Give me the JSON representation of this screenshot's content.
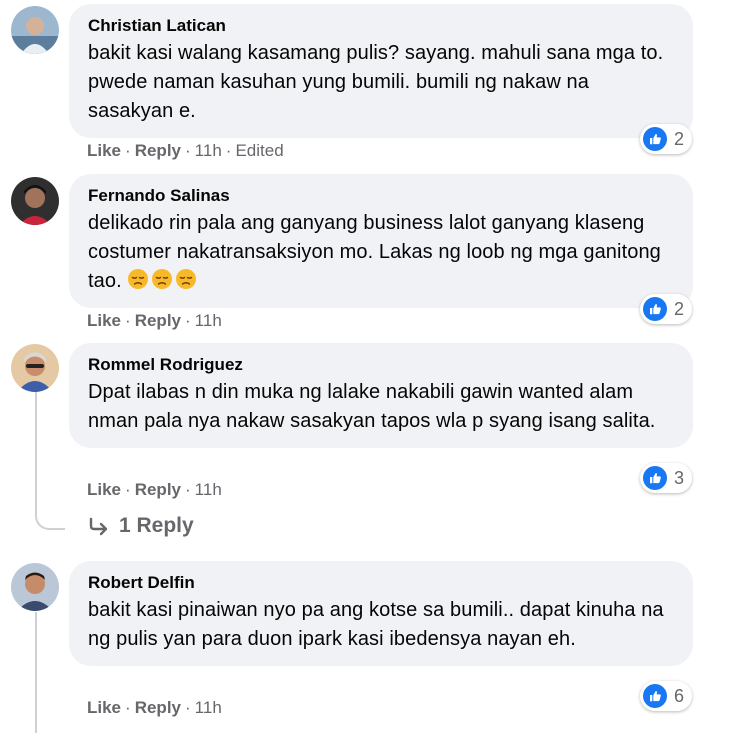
{
  "comments": [
    {
      "author": "Christian Latican",
      "text": "bakit kasi walang kasamang pulis? sayang. mahuli sana mga to. pwede naman kasuhan yung bumili. bumili ng nakaw na sasakyan e.",
      "like_label": "Like",
      "reply_label": "Reply",
      "time": "11h",
      "edited": "Edited",
      "reaction_count": "2"
    },
    {
      "author": "Fernando Salinas",
      "text": "delikado rin pala ang ganyang business lalot ganyang klaseng costumer nakatransaksiyon mo. Lakas ng loob ng mga ganitong tao.",
      "emojis": [
        "disappointed-face-icon",
        "disappointed-face-icon",
        "disappointed-face-icon"
      ],
      "like_label": "Like",
      "reply_label": "Reply",
      "time": "11h",
      "reaction_count": "2"
    },
    {
      "author": "Rommel Rodriguez",
      "text": "Dpat ilabas n din muka ng lalake nakabili gawin wanted alam nman pala nya nakaw sasakyan tapos wla p syang isang salita.",
      "like_label": "Like",
      "reply_label": "Reply",
      "time": "11h",
      "reaction_count": "3",
      "replies_label": "1 Reply"
    },
    {
      "author": "Robert Delfin",
      "text": "bakit kasi pinaiwan nyo pa ang kotse sa bumili.. dapat kinuha na ng pulis yan para duon ipark kasi ibedensya nayan eh.",
      "like_label": "Like",
      "reply_label": "Reply",
      "time": "11h",
      "reaction_count": "6"
    }
  ],
  "colors": {
    "bubble": "#f0f2f5",
    "secondary_text": "#65676b",
    "like_blue": "#1877f2"
  }
}
